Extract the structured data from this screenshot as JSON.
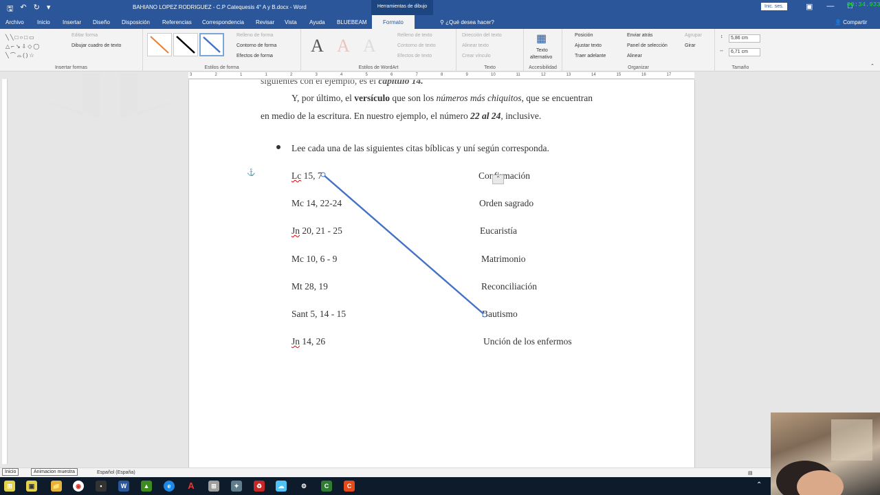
{
  "window": {
    "title": "BAHIANO LOPEZ RODRIGUEZ - C.P Catequesis 4° A y B.docx  -  Word",
    "context_tab": "Herramientas de dibujo",
    "signin": "Inic. ses.",
    "timer": "00:34.933"
  },
  "tabs": [
    {
      "label": "Archivo"
    },
    {
      "label": "Inicio"
    },
    {
      "label": "Insertar"
    },
    {
      "label": "Diseño"
    },
    {
      "label": "Disposición"
    },
    {
      "label": "Referencias"
    },
    {
      "label": "Correspondencia"
    },
    {
      "label": "Revisar"
    },
    {
      "label": "Vista"
    },
    {
      "label": "Ayuda"
    },
    {
      "label": "BLUEBEAM"
    },
    {
      "label": "Formato"
    }
  ],
  "tellme": "¿Qué desea hacer?",
  "share": "Compartir",
  "ribbon": {
    "insert_shapes": {
      "edit_shape": "Editar forma",
      "draw_textbox": "Dibujar cuadro de texto",
      "label": "Insertar formas"
    },
    "shape_styles": {
      "fill": "Relleno de forma",
      "outline": "Contorno de forma",
      "effects": "Efectos de forma",
      "label": "Estilos de forma"
    },
    "wordart": {
      "fill": "Relleno de texto",
      "outline": "Contorno de texto",
      "effects": "Efectos de texto",
      "label": "Estilos de WordArt",
      "letter": "A"
    },
    "text": {
      "direction": "Dirección del texto",
      "align": "Alinear texto",
      "link": "Crear vínculo",
      "label": "Texto"
    },
    "accessibility": {
      "alt_text_1": "Texto",
      "alt_text_2": "alternativo",
      "label": "Accesibilidad"
    },
    "arrange": {
      "position": "Posición",
      "wrap": "Ajustar texto",
      "bring_forward": "Traer adelante",
      "send_back": "Enviar atrás",
      "selection_pane": "Panel de selección",
      "align": "Alinear",
      "group": "Agrupar",
      "rotate": "Girar",
      "label": "Organizar"
    },
    "size": {
      "height": "5,86 cm",
      "width": "6,71 cm",
      "label": "Tamaño"
    }
  },
  "ruler": {
    "h_labels": [
      "3",
      "2",
      "1",
      "1",
      "2",
      "3",
      "4",
      "5",
      "6",
      "7",
      "8",
      "9",
      "10",
      "11",
      "12",
      "13",
      "14",
      "15",
      "16",
      "17"
    ]
  },
  "document": {
    "line_top_pre": "siguientes con el ejemplo, es el ",
    "line_top_bold": "capítulo 14.",
    "para_1_start": "Y, por último, el ",
    "para_1_bold": "versículo",
    "para_1_mid": " que son los ",
    "para_1_italic": "números más chiquitos,",
    "para_1_end": " que se encuentran",
    "para_2_start": "en medio de la escritura. En nuestro ejemplo, el número ",
    "para_2_bold": "22 al 24",
    "para_2_end": ", inclusive.",
    "bullet_text": "Lee cada una de las siguientes citas bíblicas y uní según corresponda.",
    "citations": [
      {
        "pre": "",
        "abbr": "Lc",
        "rest": " 15, 7"
      },
      {
        "pre": "Mc 14, 22-24",
        "abbr": "",
        "rest": ""
      },
      {
        "pre": "",
        "abbr": "Jn",
        "rest": " 20, 21 - 25"
      },
      {
        "pre": "Mc 10, 6 - 9",
        "abbr": "",
        "rest": ""
      },
      {
        "pre": "Mt 28, 19",
        "abbr": "",
        "rest": ""
      },
      {
        "pre": "Sant 5, 14 - 15",
        "abbr": "",
        "rest": ""
      },
      {
        "pre": "",
        "abbr": "Jn",
        "rest": " 14, 26"
      }
    ],
    "sacraments": [
      "Confirmación",
      "Orden sagrado",
      "Eucaristía",
      "Matrimonio",
      "Reconciliación",
      "Bautismo",
      "Unción de los enfermos"
    ]
  },
  "status": {
    "language": "Español (España)",
    "tooltip_start": "Inicio",
    "tooltip_anim": "Animacion muestra"
  },
  "colors": {
    "word_blue": "#2b579a",
    "arrow": "#4472c4",
    "timer": "#19e619"
  }
}
